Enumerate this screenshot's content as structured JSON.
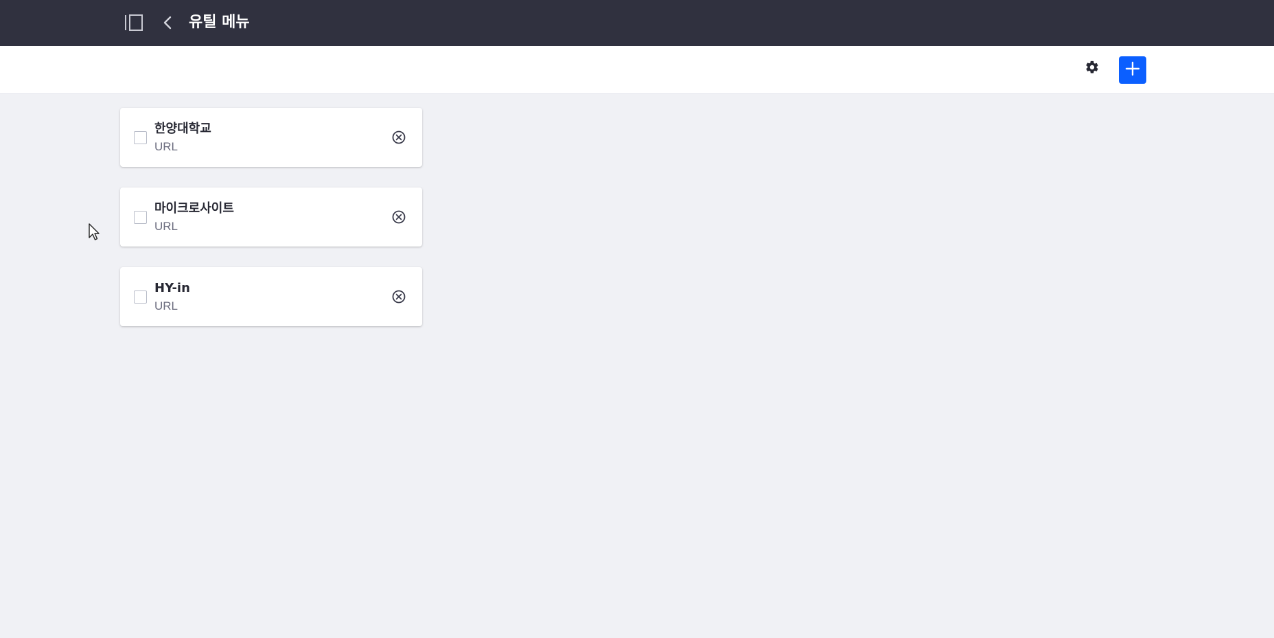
{
  "header": {
    "title": "유틸 메뉴",
    "sidebar_toggle_icon": "sidebar-panel-icon",
    "back_icon": "chevron-left-icon",
    "background": "#30313f"
  },
  "toolbar": {
    "settings_icon": "gear-icon",
    "add_icon": "plus-icon",
    "accent": "#0b5fff"
  },
  "items": [
    {
      "name": "한양대학교",
      "type": "URL"
    },
    {
      "name": "마이크로사이트",
      "type": "URL"
    },
    {
      "name": "HY-in",
      "type": "URL"
    }
  ]
}
